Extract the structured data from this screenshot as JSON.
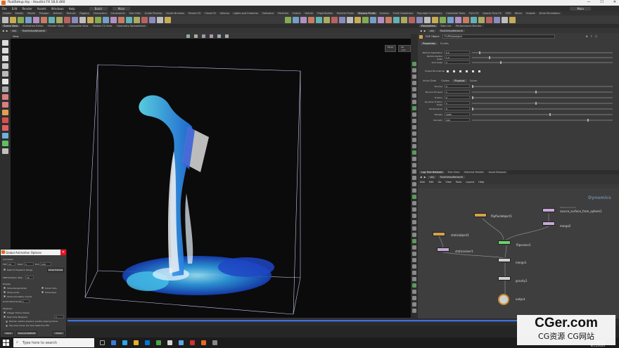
{
  "titlebar": {
    "title": "fluidSetup.hip - Houdini FX 18.0.460",
    "min": "—",
    "max": "☐",
    "close": "✕"
  },
  "menubar": {
    "items": [
      "File",
      "Edit",
      "Render",
      "Assets",
      "Windows",
      "Help"
    ],
    "desktop": "Build",
    "mode": "Main"
  },
  "shelf_tabs": [
    "Create",
    "Modify",
    "Model",
    "Polygon",
    "Deform",
    "Texture",
    "Rigging",
    "Characters",
    "Constraints",
    "Hair Utils",
    "Guide Process",
    "Guide Brushes",
    "Terrain FX",
    "Cloud FX",
    "Volume",
    "Lights and Cameras",
    "Collisions",
    "Particles",
    "Grains",
    "Vellum",
    "Rigid Bodies",
    "Particle Fluids",
    "Viscous Fluids",
    "Oceans",
    "Fluid Containers",
    "Populate Containers",
    "Container Tools",
    "Pyro FX",
    "Sparse Pyro FX",
    "FEM",
    "Wires",
    "Crowds",
    "Drive Simulation"
  ],
  "viewport_tabs": [
    "Scene View",
    "Animation Editor",
    "Render View",
    "Composite View",
    "Motion FX View",
    "Geometry Spreadsheet"
  ],
  "viewport_path": {
    "obj": "obj",
    "node": "fluidSetupNetwork"
  },
  "viewport": {
    "label": "View",
    "persp": "Persp",
    "cam": "No cam"
  },
  "param_tabs": [
    "Parameters",
    "Take List",
    "Performance Monitor"
  ],
  "param_path": {
    "obj": "obj",
    "node": "fluidSetupNetwork"
  },
  "param_header": {
    "type": "FLIP Object",
    "name": "FLIPfluidobject"
  },
  "param_subtabs": [
    "Properties",
    "Guides"
  ],
  "params": [
    {
      "label": "Particle Separation",
      "value": "0.2",
      "slider": 0.05
    },
    {
      "label": "Particle Radius Scale",
      "value": "1.2",
      "slider": 0.12
    },
    {
      "label": "Grid Scale",
      "value": "2",
      "slider": 0.2
    }
  ],
  "closed_boundaries_label": "Closed Boundaries",
  "param_subtabs2": [
    "Initial Data",
    "Guides",
    "Physical",
    "Solver"
  ],
  "params2": [
    {
      "label": "Bounce",
      "value": "0",
      "slider": 0.0
    },
    {
      "label": "Bounce Forward",
      "value": "1",
      "slider": 0.45
    },
    {
      "label": "Friction",
      "value": "0",
      "slider": 0.0
    },
    {
      "label": "Dynamic Friction Scale",
      "value": "1",
      "slider": 0.45
    },
    {
      "label": "Temperature",
      "value": "0",
      "slider": 0.0
    },
    {
      "label": "Density",
      "value": "1000",
      "slider": 0.55
    },
    {
      "label": "Viscosity",
      "value": "100",
      "slider": 0.82
    }
  ],
  "network_tabs": [
    "Log Tree Network",
    "Tree View",
    "Material Palette",
    "Asset Browser"
  ],
  "network_path": {
    "obj": "obj",
    "node": "fluidSetupNetwork"
  },
  "network_menu": [
    "Add",
    "Edit",
    "Go",
    "View",
    "Tools",
    "Layout",
    "Help"
  ],
  "network_label": "Dynamics",
  "nodes": [
    {
      "id": "flipfluidobject1",
      "label": "flipfluidobject1",
      "sub": "",
      "color": "#d4a24a"
    },
    {
      "id": "source_surface_from_sphere1",
      "label": "source_surface_from_sphere1",
      "sub": "Volume Source",
      "color": "#c8a8d8"
    },
    {
      "id": "staticobject1",
      "label": "staticobject1",
      "sub": "",
      "color": "#d4a24a"
    },
    {
      "id": "merge2",
      "label": "merge2",
      "sub": "",
      "color": "#c8a8d8"
    },
    {
      "id": "flipsolver1",
      "label": "flipsolver1",
      "sub": "",
      "color": "#6ed06e"
    },
    {
      "id": "staticsolver1",
      "label": "staticsolver1",
      "sub": "",
      "color": "#c8a8d8"
    },
    {
      "id": "merge1",
      "label": "merge1",
      "sub": "",
      "color": "#d0d0d0"
    },
    {
      "id": "gravity1",
      "label": "gravity1",
      "sub": "",
      "color": "#d0d0d0"
    },
    {
      "id": "output",
      "label": "output",
      "sub": "",
      "color": "#d0d0d0"
    }
  ],
  "dialog": {
    "title": "Global Animation Options",
    "close": "✕",
    "animation_label": "Animation",
    "fps_label": "FPS",
    "fps_value": "24",
    "start_label": "Start",
    "start_value": "1",
    "end_label": "End",
    "end_value": "240",
    "restrict_label": "Restrict Playback Range",
    "frames_label": "Show Frames",
    "step_label": "MRP Notation Step",
    "step_value": "10",
    "display_label": "Display",
    "show_range": "Show Range Slider",
    "show_audio": "Show Audio",
    "show_keys": "Show Keys",
    "show_ticks": "Show Ticks",
    "show_simcache": "Show Simulation Cache",
    "audio_scale_label": "Audio Panel Scale",
    "audio_scale_value": "1",
    "playback_label": "Playback",
    "integer_label": "Integer Frame Values",
    "realtime_label": "Real Time Playback",
    "realtime_factor": "1",
    "note1": "Maintain realtime playback, possibly skipping frames",
    "note2": "Play every frame, but never faster than FPS",
    "save_btn": "Save",
    "save_default_btn": "Save as Default",
    "close_btn": "Close"
  },
  "taskbar": {
    "search": "Type here to search",
    "time": "5:34 PM",
    "date": "8/11/2020"
  },
  "watermark": {
    "line1": "CGer.com",
    "line2": "CG资源 CG网站"
  },
  "colors": {
    "accent_blue": "#3f73d6",
    "fluid_cyan": "#39c9e8",
    "fluid_deep": "#1d4fd6",
    "bg": "#3a3a3a"
  }
}
